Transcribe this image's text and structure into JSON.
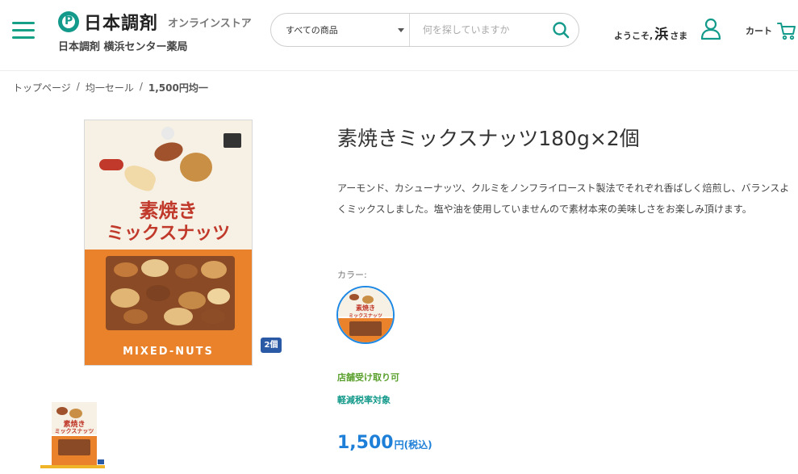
{
  "header": {
    "logo_text": "日本調剤",
    "logo_sub": "オンラインストア",
    "store_name": "日本調剤 横浜センター薬局",
    "search": {
      "category_selected": "すべての商品",
      "placeholder": "何を探していますか"
    },
    "welcome_prefix": "ようこそ,",
    "user_name": "浜",
    "welcome_suffix": "さま",
    "cart_label": "カート"
  },
  "breadcrumb": [
    "トップページ",
    "均一セール",
    "1,500円均一"
  ],
  "product": {
    "title": "素焼きミックスナッツ180g×2個",
    "description": "アーモンド、カシューナッツ、クルミをノンフライロースト製法でそれぞれ香ばしく焙煎し、バランスよくミックスしました。塩や油を使用していませんので素材本来の美味しさをお楽しみ頂けます。",
    "color_label": "カラー:",
    "pickup": "店舗受け取り可",
    "tax_note": "軽減税率対象",
    "price": "1,500",
    "price_unit": "円(税込)",
    "quantity_badge": "2個"
  },
  "package": {
    "title_line1": "素焼き",
    "title_line2": "ミックスナッツ",
    "english": "MIXED-NUTS",
    "thumb_line1": "素焼き",
    "thumb_line2": "ミックスナッツ"
  },
  "colors": {
    "brand_green": "#149a8b",
    "accent_blue": "#1e7fd8",
    "pickup_green": "#5aa02c",
    "package_orange": "#e9822a",
    "package_red": "#c0392b"
  }
}
